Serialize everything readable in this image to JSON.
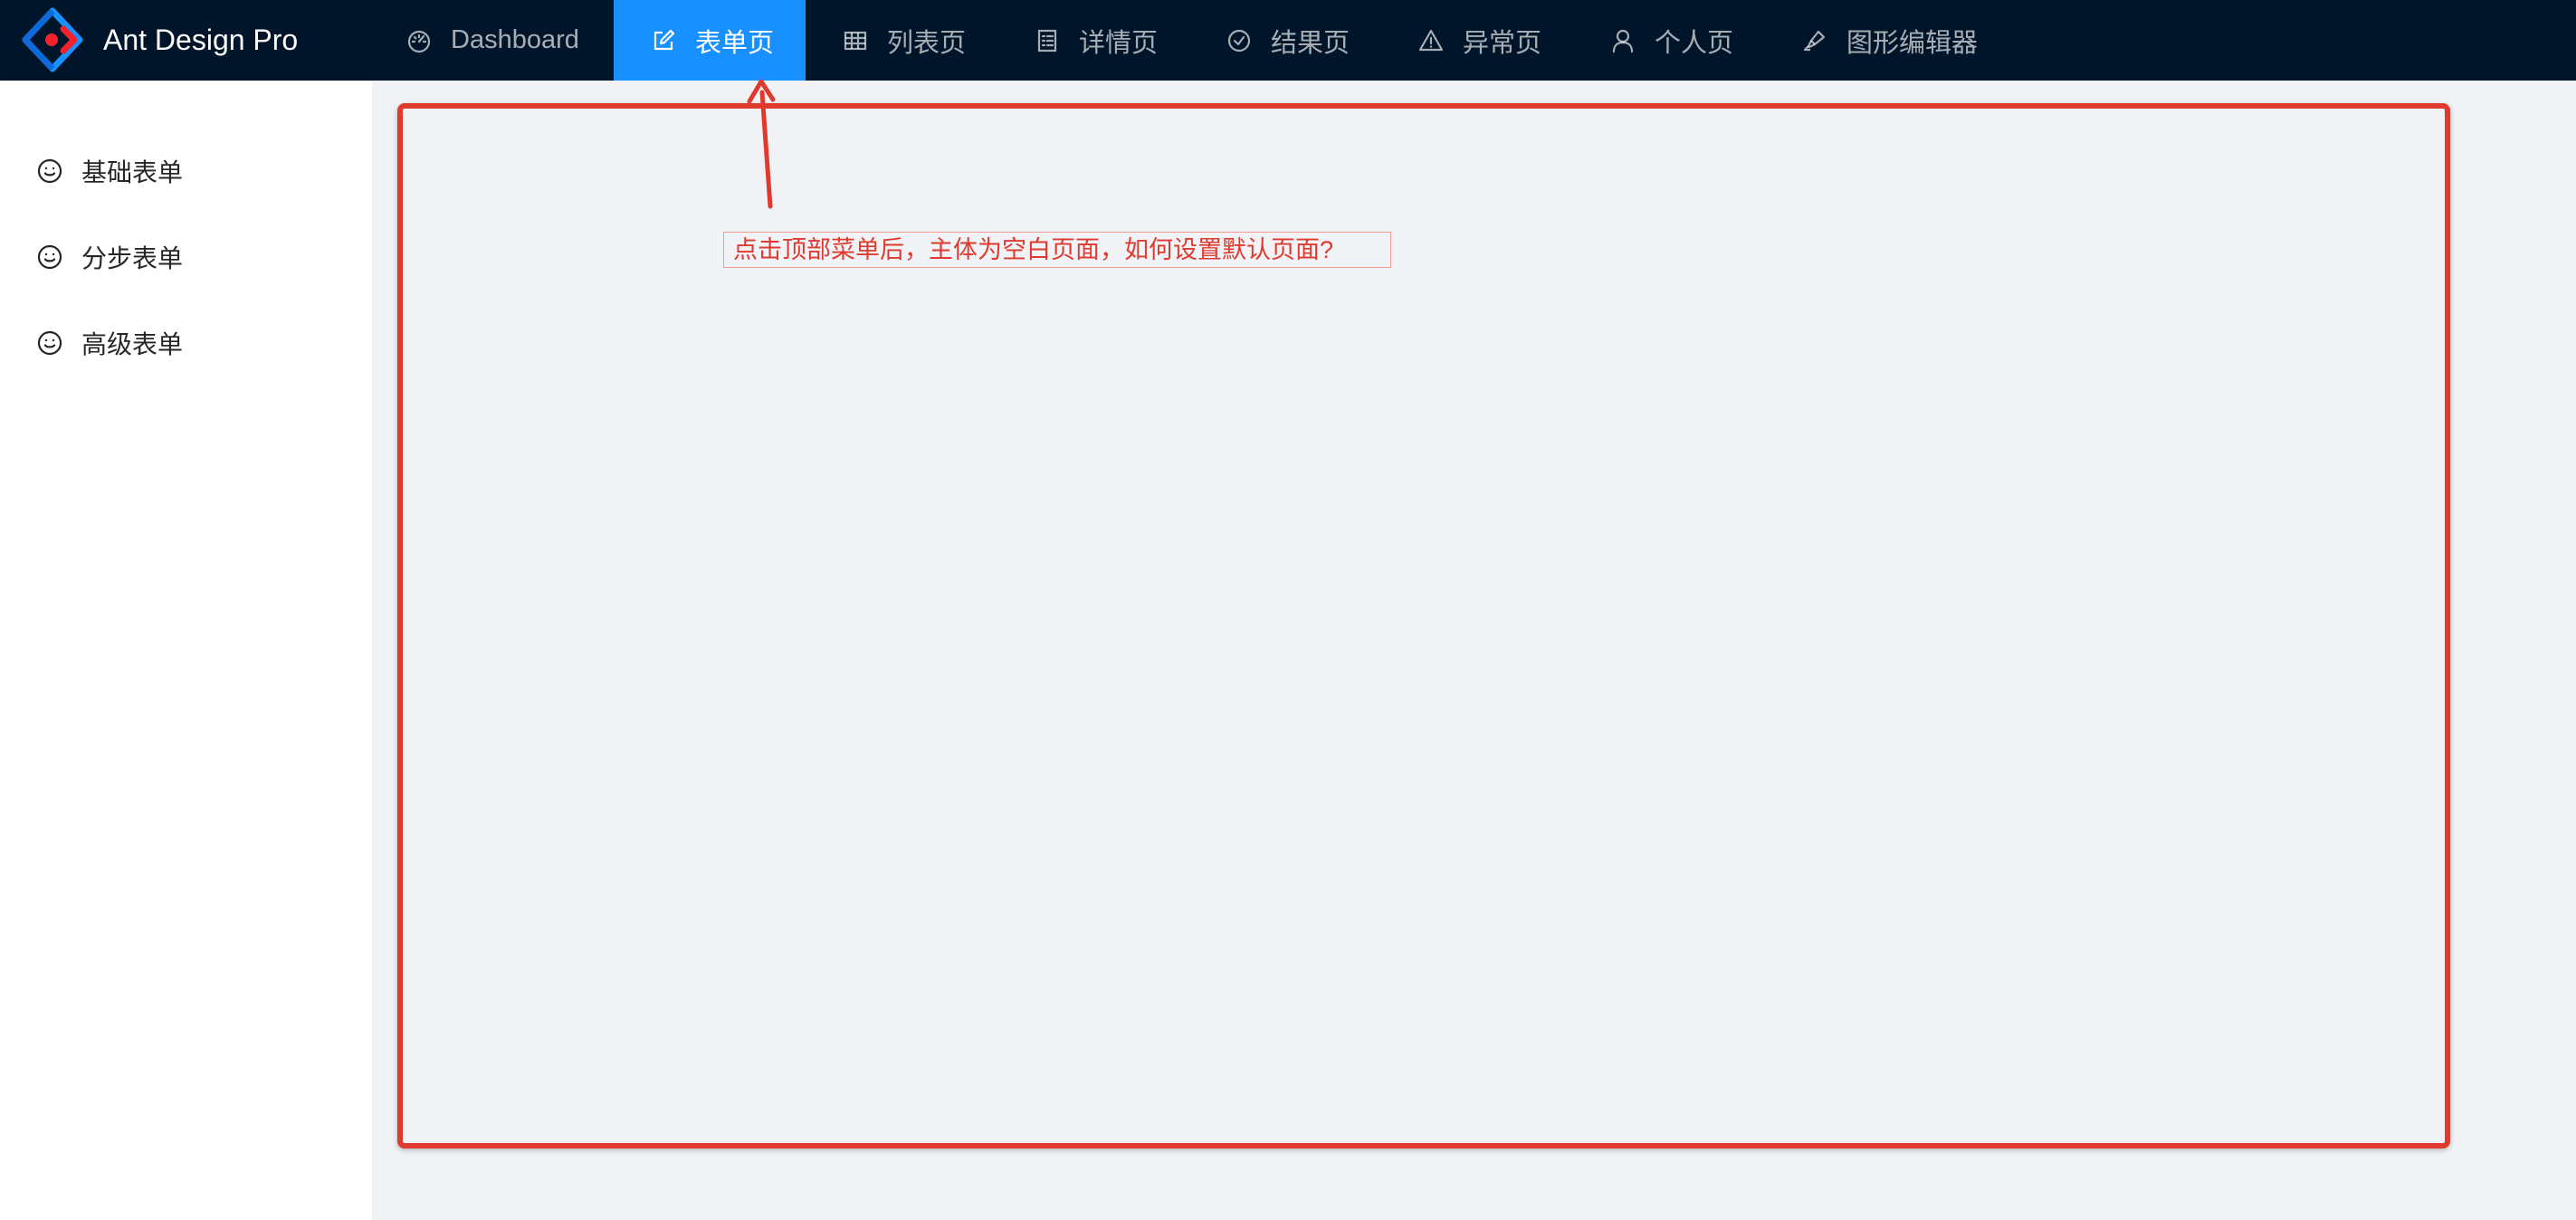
{
  "header": {
    "app_title": "Ant Design Pro",
    "logo_icon": "ant-design-logo-icon",
    "menu": [
      {
        "label": "Dashboard",
        "icon": "dashboard-icon",
        "active": false
      },
      {
        "label": "表单页",
        "icon": "form-icon",
        "active": true
      },
      {
        "label": "列表页",
        "icon": "table-icon",
        "active": false
      },
      {
        "label": "详情页",
        "icon": "profile-icon",
        "active": false
      },
      {
        "label": "结果页",
        "icon": "check-circle-icon",
        "active": false
      },
      {
        "label": "异常页",
        "icon": "warning-icon",
        "active": false
      },
      {
        "label": "个人页",
        "icon": "user-icon",
        "active": false
      },
      {
        "label": "图形编辑器",
        "icon": "highlight-icon",
        "active": false
      }
    ]
  },
  "sidebar": {
    "items": [
      {
        "label": "基础表单",
        "icon": "smile-icon"
      },
      {
        "label": "分步表单",
        "icon": "smile-icon"
      },
      {
        "label": "高级表单",
        "icon": "smile-icon"
      }
    ]
  },
  "annotation": {
    "text": "点击顶部菜单后，主体为空白页面，如何设置默认页面?"
  },
  "colors": {
    "header_bg": "#001529",
    "active_menu_bg": "#1890ff",
    "content_bg": "#f0f2f5",
    "annotation_red": "#e03a2e"
  }
}
